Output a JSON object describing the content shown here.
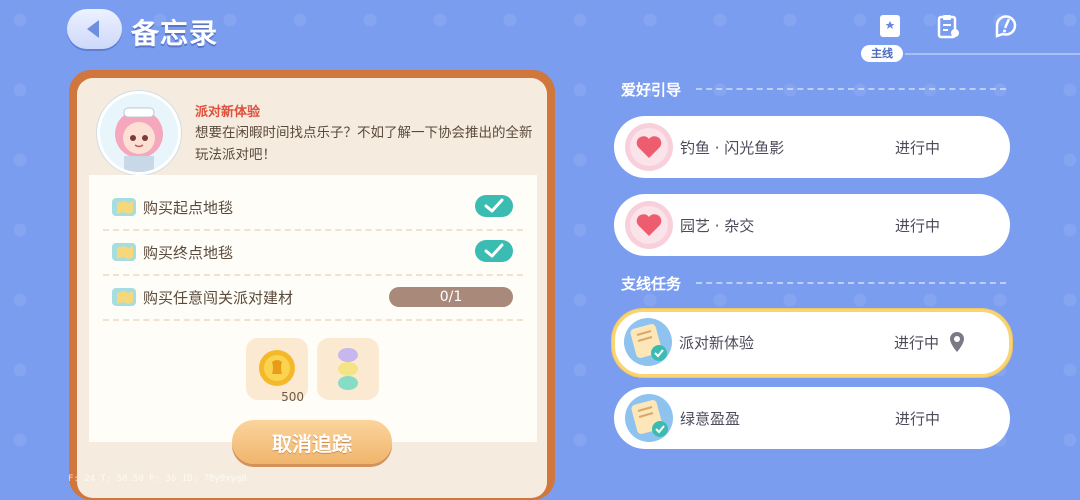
{
  "header": {
    "title": "备忘录",
    "main_tag": "主线",
    "icons": [
      "book-icon",
      "clipboard-icon",
      "quest-chat-icon"
    ]
  },
  "detail": {
    "quest_name": "派对新体验",
    "description": "想要在闲暇时间找点乐子？不如了解一下协会推出的全新玩法派对吧！",
    "tasks": [
      {
        "label": "购买起点地毯",
        "done": true
      },
      {
        "label": "购买终点地毯",
        "done": true
      },
      {
        "label": "购买任意闯关派对建材",
        "progress": "0/1"
      }
    ],
    "rewards": [
      {
        "icon": "coin-icon",
        "qty": "500"
      },
      {
        "icon": "macaron-icon",
        "qty": ""
      }
    ],
    "cancel_button": "取消追踪"
  },
  "debug_text": "F: 24    T: 58.50    P: 36    ID: 78y9xyg8",
  "sections": [
    {
      "title": "爱好引导",
      "items": [
        {
          "name": "钓鱼 · 闪光鱼影",
          "status": "进行中"
        },
        {
          "name": "园艺 · 杂交",
          "status": "进行中"
        }
      ]
    },
    {
      "title": "支线任务",
      "items": [
        {
          "name": "派对新体验",
          "status": "进行中"
        },
        {
          "name": "绿意盈盈",
          "status": "进行中"
        }
      ]
    }
  ],
  "colors": {
    "background": "#7b9df0",
    "card_border": "#d0773e",
    "accent_check": "#3bbcb2",
    "title_red": "#e0503c"
  }
}
